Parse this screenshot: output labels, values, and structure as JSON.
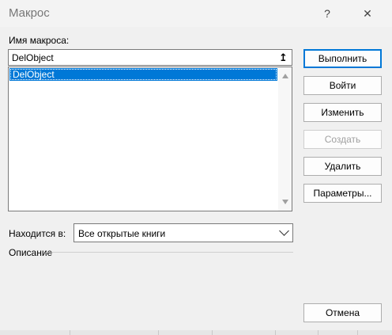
{
  "window": {
    "title": "Макрос",
    "help": "?",
    "close": "✕"
  },
  "macro_name": {
    "label": "Имя макроса:",
    "value": "DelObject"
  },
  "macro_list": {
    "items": [
      "DelObject"
    ],
    "selected": "DelObject"
  },
  "buttons": {
    "run": "Выполнить",
    "step_into": "Войти",
    "edit": "Изменить",
    "create": "Создать",
    "delete": "Удалить",
    "options": "Параметры...",
    "cancel": "Отмена"
  },
  "location": {
    "label": "Находится в:",
    "value": "Все открытые книги"
  },
  "description": {
    "label": "Описание"
  },
  "colors": {
    "selection": "#0078d7",
    "primary_border": "#0078d7"
  }
}
